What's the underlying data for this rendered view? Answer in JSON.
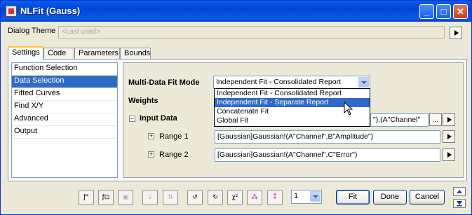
{
  "window": {
    "title": "NLFit (Gauss)",
    "controls": {
      "minimize": "_",
      "maximize": "□",
      "close": "✕"
    }
  },
  "dialog_theme": {
    "label": "Dialog Theme",
    "value": "<Last used>"
  },
  "tabs": [
    "Settings",
    "Code",
    "Parameters",
    "Bounds"
  ],
  "active_tab": "Settings",
  "nav": {
    "items": [
      "Function Selection",
      "Data Selection",
      "Fitted Curves",
      "Find X/Y",
      "Advanced",
      "Output"
    ],
    "selected": "Data Selection"
  },
  "settings": {
    "multi_data_fit_mode_label": "Multi-Data Fit Mode",
    "multi_data_fit_mode_value": "Independent Fit - Consolidated Report",
    "mode_options": [
      "Independent Fit - Consolidated Report",
      "Independent Fit - Separate Report",
      "Concatenate Fit",
      "Global Fit"
    ],
    "highlighted_option": "Independent Fit - Separate Report",
    "weights_label": "Weights",
    "input_data_label": "Input Data",
    "input_data_value": "\"),(A\"Channel\"",
    "expand_glyph": "−",
    "collapse_glyph": "+",
    "ellipsis": "...",
    "range1_label": "Range 1",
    "range1_value": "[Gaussian]Gaussian!(A\"Channel\",B\"Amplitude\")",
    "range2_label": "Range 2",
    "range2_value": "[Gaussian]Gaussian!(A\"Channel\",C\"Error\")"
  },
  "toolbar": {
    "icons": [
      "fit-param-icon",
      "fit-func-icon",
      "save-icon",
      "sort-down-icon",
      "sort-icon",
      "rotate-p-icon",
      "rotate-s-icon",
      "chi-square-icon",
      "iterate-icon",
      "fit-until-converge-icon"
    ],
    "chi_square": "χ²",
    "iteration_value": "1",
    "fit_label": "Fit",
    "done_label": "Done",
    "cancel_label": "Cancel"
  },
  "colors": {
    "titlebar": "#0a5ee9",
    "selection": "#316ac5",
    "dialog_bg": "#ece9d8"
  }
}
